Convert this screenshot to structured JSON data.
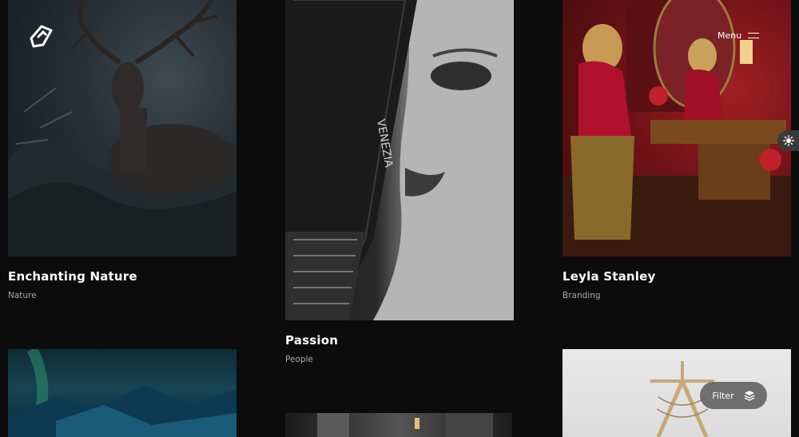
{
  "nav": {
    "menu_label": "Menu",
    "filter_label": "Filter"
  },
  "portfolio": {
    "items": [
      {
        "title": "Enchanting Nature",
        "category": "Nature"
      },
      {
        "title": "Passion",
        "category": "People"
      },
      {
        "title": "Leyla Stanley",
        "category": "Branding"
      }
    ]
  },
  "photo_text": {
    "fan_word": "VENEZIA"
  },
  "icons": {
    "logo": "logo-mark-icon",
    "menu": "hamburger-icon",
    "theme": "sun-icon",
    "filter": "layers-icon"
  },
  "colors": {
    "background": "#0c0c0c",
    "text": "#ffffff",
    "muted": "#a9a9a9",
    "pill": "#5a5a5a"
  }
}
